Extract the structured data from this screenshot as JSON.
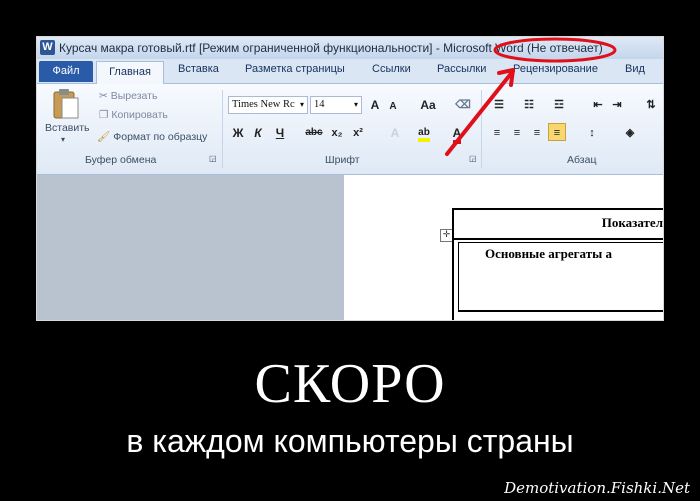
{
  "window": {
    "title": "Курсач макра готовый.rtf [Режим ограниченной функциональности] - Microsoft Word (Не отвечает)",
    "app_icon": "word-icon"
  },
  "tabs": [
    {
      "label": "Файл"
    },
    {
      "label": "Главная"
    },
    {
      "label": "Вставка"
    },
    {
      "label": "Разметка страницы"
    },
    {
      "label": "Ссылки"
    },
    {
      "label": "Рассылки"
    },
    {
      "label": "Рецензирование"
    },
    {
      "label": "Вид"
    }
  ],
  "clipboard": {
    "paste": "Вставить",
    "cut": "Вырезать",
    "copy": "Копировать",
    "format_painter": "Формат по образцу",
    "group_title": "Буфер обмена"
  },
  "font": {
    "family": "Times New Rc",
    "size": "14",
    "group_title": "Шрифт",
    "bold": "Ж",
    "italic": "К",
    "underline": "Ч",
    "strike": "abc",
    "subscript": "x₂",
    "superscript": "x²",
    "grow": "A",
    "shrink": "A",
    "case": "Aa"
  },
  "paragraph": {
    "group_title": "Абзац"
  },
  "document": {
    "header_cell": "Показател",
    "row_cell": "Основные агрегаты а"
  },
  "caption": {
    "main": "СКОРО",
    "sub": "в каждом компьютеры страны"
  },
  "watermark": "Demotivation.Fishki.Net",
  "colors": {
    "annotation_red": "#e0101a",
    "file_tab": "#2a5ba8"
  }
}
